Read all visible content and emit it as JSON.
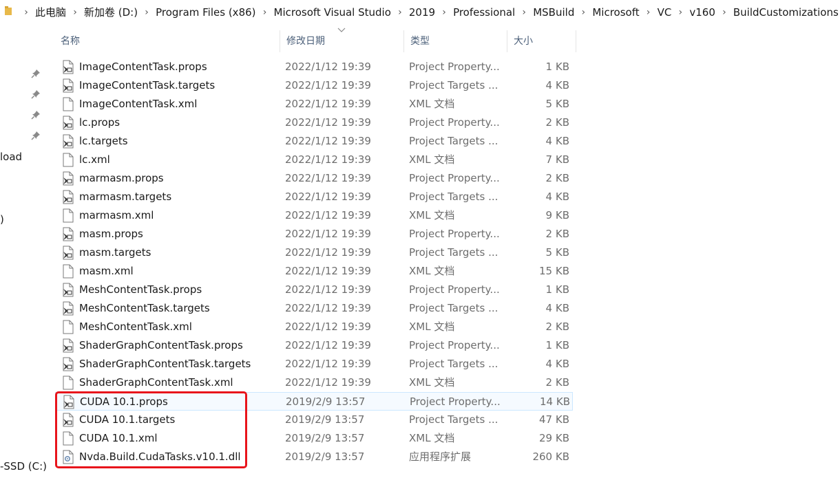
{
  "breadcrumb": [
    "此电脑",
    "新加卷 (D:)",
    "Program Files (x86)",
    "Microsoft Visual Studio",
    "2019",
    "Professional",
    "MSBuild",
    "Microsoft",
    "VC",
    "v160",
    "BuildCustomizations"
  ],
  "breadcrumb_separator": "›",
  "nav": {
    "label_download": "load",
    "label_paren": ")",
    "label_drive": "-SSD (C:)"
  },
  "columns": {
    "name": "名称",
    "date": "修改日期",
    "type": "类型",
    "size": "大小"
  },
  "highlight_color": "#e8141b",
  "selection_color": "#cce8ff",
  "files": [
    {
      "name": "ImageContentTask.props",
      "date": "2022/1/12 19:39",
      "type": "Project Property...",
      "size": "1 KB",
      "icon": "project-file-icon"
    },
    {
      "name": "ImageContentTask.targets",
      "date": "2022/1/12 19:39",
      "type": "Project Targets ...",
      "size": "4 KB",
      "icon": "project-file-icon"
    },
    {
      "name": "ImageContentTask.xml",
      "date": "2022/1/12 19:39",
      "type": "XML 文档",
      "size": "5 KB",
      "icon": "document-icon"
    },
    {
      "name": "lc.props",
      "date": "2022/1/12 19:39",
      "type": "Project Property...",
      "size": "2 KB",
      "icon": "project-file-icon"
    },
    {
      "name": "lc.targets",
      "date": "2022/1/12 19:39",
      "type": "Project Targets ...",
      "size": "4 KB",
      "icon": "project-file-icon"
    },
    {
      "name": "lc.xml",
      "date": "2022/1/12 19:39",
      "type": "XML 文档",
      "size": "7 KB",
      "icon": "document-icon"
    },
    {
      "name": "marmasm.props",
      "date": "2022/1/12 19:39",
      "type": "Project Property...",
      "size": "2 KB",
      "icon": "project-file-icon"
    },
    {
      "name": "marmasm.targets",
      "date": "2022/1/12 19:39",
      "type": "Project Targets ...",
      "size": "4 KB",
      "icon": "project-file-icon"
    },
    {
      "name": "marmasm.xml",
      "date": "2022/1/12 19:39",
      "type": "XML 文档",
      "size": "9 KB",
      "icon": "document-icon"
    },
    {
      "name": "masm.props",
      "date": "2022/1/12 19:39",
      "type": "Project Property...",
      "size": "2 KB",
      "icon": "project-file-icon"
    },
    {
      "name": "masm.targets",
      "date": "2022/1/12 19:39",
      "type": "Project Targets ...",
      "size": "5 KB",
      "icon": "project-file-icon"
    },
    {
      "name": "masm.xml",
      "date": "2022/1/12 19:39",
      "type": "XML 文档",
      "size": "15 KB",
      "icon": "document-icon"
    },
    {
      "name": "MeshContentTask.props",
      "date": "2022/1/12 19:39",
      "type": "Project Property...",
      "size": "1 KB",
      "icon": "project-file-icon"
    },
    {
      "name": "MeshContentTask.targets",
      "date": "2022/1/12 19:39",
      "type": "Project Targets ...",
      "size": "4 KB",
      "icon": "project-file-icon"
    },
    {
      "name": "MeshContentTask.xml",
      "date": "2022/1/12 19:39",
      "type": "XML 文档",
      "size": "2 KB",
      "icon": "document-icon"
    },
    {
      "name": "ShaderGraphContentTask.props",
      "date": "2022/1/12 19:39",
      "type": "Project Property...",
      "size": "1 KB",
      "icon": "project-file-icon"
    },
    {
      "name": "ShaderGraphContentTask.targets",
      "date": "2022/1/12 19:39",
      "type": "Project Targets ...",
      "size": "4 KB",
      "icon": "project-file-icon"
    },
    {
      "name": "ShaderGraphContentTask.xml",
      "date": "2022/1/12 19:39",
      "type": "XML 文档",
      "size": "2 KB",
      "icon": "document-icon"
    },
    {
      "name": "CUDA 10.1.props",
      "date": "2019/2/9 13:57",
      "type": "Project Property...",
      "size": "14 KB",
      "icon": "project-file-icon",
      "selected": true
    },
    {
      "name": "CUDA 10.1.targets",
      "date": "2019/2/9 13:57",
      "type": "Project Targets ...",
      "size": "47 KB",
      "icon": "project-file-icon"
    },
    {
      "name": "CUDA 10.1.xml",
      "date": "2019/2/9 13:57",
      "type": "XML 文档",
      "size": "29 KB",
      "icon": "document-icon"
    },
    {
      "name": "Nvda.Build.CudaTasks.v10.1.dll",
      "date": "2019/2/9 13:57",
      "type": "应用程序扩展",
      "size": "260 KB",
      "icon": "dll-file-icon"
    }
  ]
}
